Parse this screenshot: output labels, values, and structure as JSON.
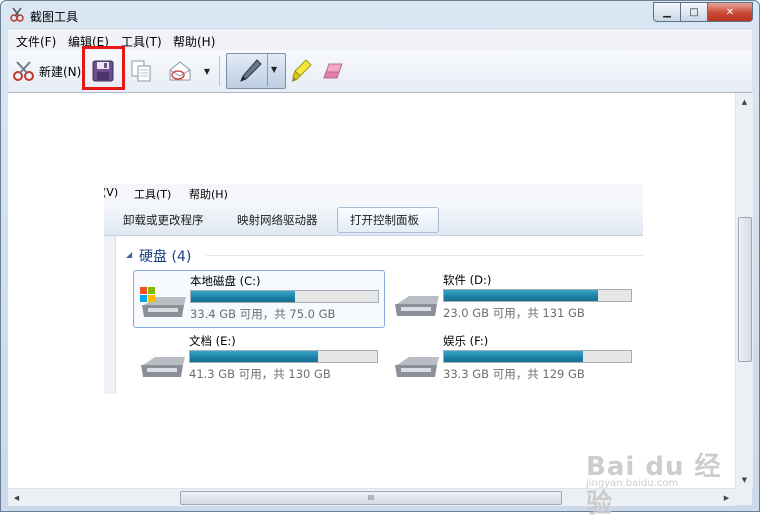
{
  "window": {
    "title": "截图工具",
    "caption_buttons": {
      "minimize": "▁",
      "maximize": "□",
      "close": "✕"
    }
  },
  "menu": [
    {
      "label": "文件(F)"
    },
    {
      "label": "编辑(E)"
    },
    {
      "label": "工具(T)"
    },
    {
      "label": "帮助(H)"
    }
  ],
  "toolbar": {
    "new_label": "新建(N)",
    "icons": [
      "scissors-icon",
      "save-icon",
      "copy-icon",
      "send-email-icon",
      "dropdown-arrow-icon",
      "pen-icon",
      "highlighter-icon",
      "eraser-icon"
    ],
    "highlight_color": "#e51717"
  },
  "capture": {
    "menu": [
      "(V)",
      "工具(T)",
      "帮助(H)"
    ],
    "commands": [
      "卸载或更改程序",
      "映射网络驱动器",
      "打开控制面板"
    ],
    "group_title": "硬盘 (4)",
    "drives": [
      {
        "name": "本地磁盘 (C:)",
        "info": "33.4 GB 可用，共 75.0 GB",
        "used_fraction": 0.555,
        "os_drive": true
      },
      {
        "name": "软件 (D:)",
        "info": "23.0 GB 可用，共 131 GB",
        "used_fraction": 0.824,
        "os_drive": false
      },
      {
        "name": "文档 (E:)",
        "info": "41.3 GB 可用，共 130 GB",
        "used_fraction": 0.682,
        "os_drive": false
      },
      {
        "name": "娱乐 (F:)",
        "info": "33.3 GB 可用，共 129 GB",
        "used_fraction": 0.742,
        "os_drive": false
      }
    ],
    "bar_color": "#1f86ab"
  },
  "scrollbars": {
    "h_grip": "III"
  },
  "watermark": {
    "brand": "Bai du 经验",
    "sub": "jingyan.baidu.com"
  }
}
